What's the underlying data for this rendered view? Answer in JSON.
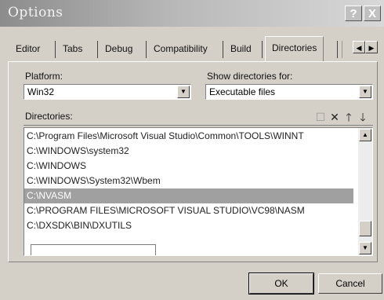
{
  "window": {
    "title": "Options",
    "help_glyph": "?",
    "close_glyph": "X"
  },
  "tabs": [
    {
      "label": "Editor"
    },
    {
      "label": "Tabs"
    },
    {
      "label": "Debug"
    },
    {
      "label": "Compatibility"
    },
    {
      "label": "Build"
    },
    {
      "label": "Directories",
      "active": true
    }
  ],
  "tab_scroll": {
    "left": "◀",
    "right": "▶"
  },
  "platform": {
    "label": "Platform:",
    "value": "Win32"
  },
  "show_dirs": {
    "label": "Show directories for:",
    "value": "Executable files"
  },
  "directories": {
    "label": "Directories:",
    "tools": {
      "new": "☐",
      "delete": "✕",
      "up": "🡑",
      "down": "🡓"
    },
    "items": [
      "C:\\Program Files\\Microsoft Visual Studio\\Common\\TOOLS\\WINNT",
      "C:\\WINDOWS\\system32",
      "C:\\WINDOWS",
      "C:\\WINDOWS\\System32\\Wbem",
      "C:\\NVASM",
      "C:\\PROGRAM FILES\\MICROSOFT VISUAL STUDIO\\VC98\\NASM",
      "C:\\DXSDK\\BIN\\DXUTILS"
    ],
    "selected_index": 4
  },
  "buttons": {
    "ok": "OK",
    "cancel": "Cancel"
  }
}
